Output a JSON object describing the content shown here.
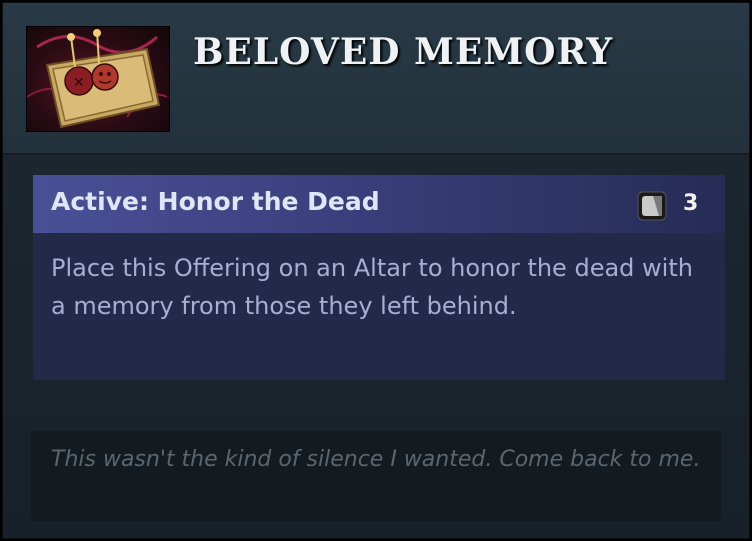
{
  "item": {
    "title": "BELOVED MEMORY",
    "icon": "beloved-memory-item-icon"
  },
  "ability": {
    "name": "Active: Honor the Dead",
    "cooldown_icon": "charges-icon",
    "cooldown_value": "3",
    "description": "Place this Offering on an Altar to honor the dead with a memory from those they left behind."
  },
  "lore": {
    "text": "This wasn't the kind of silence I wanted. Come back to me."
  },
  "colors": {
    "background": "#1b262e",
    "ability_header": "#4a5096",
    "ability_body": "#222949",
    "lore_box": "#141b20"
  }
}
